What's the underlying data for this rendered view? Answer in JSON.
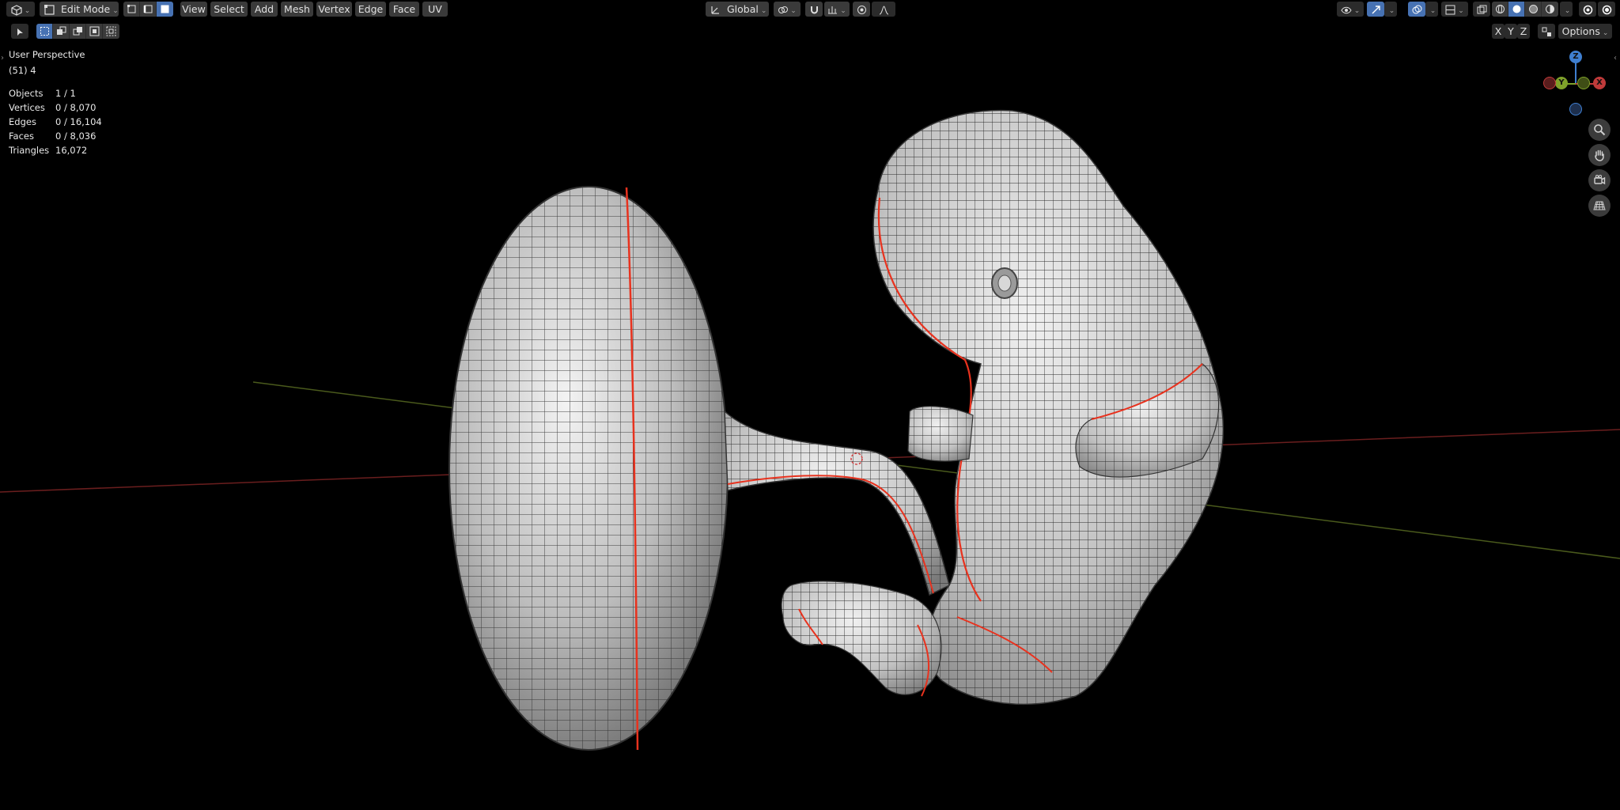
{
  "header": {
    "mode_label": "Edit Mode",
    "menus": [
      "View",
      "Select",
      "Add",
      "Mesh",
      "Vertex",
      "Edge",
      "Face",
      "UV"
    ],
    "transform_orientation": "Global",
    "axis_buttons": [
      "X",
      "Y",
      "Z"
    ],
    "options_label": "Options"
  },
  "overlay": {
    "view_name": "User Perspective",
    "object_info": "(51) 4",
    "stats": [
      {
        "label": "Objects",
        "value": "1 / 1"
      },
      {
        "label": "Vertices",
        "value": "0 / 8,070"
      },
      {
        "label": "Edges",
        "value": "0 / 16,104"
      },
      {
        "label": "Faces",
        "value": "0 / 8,036"
      },
      {
        "label": "Triangles",
        "value": "16,072"
      }
    ]
  },
  "gizmo": {
    "z_label": "Z",
    "y_label": "Y",
    "x_label": "X"
  },
  "colors": {
    "accent": "#4772b3",
    "seam": "#e8321e",
    "axis_x": "#c03a3a",
    "axis_y": "#7fa12a",
    "axis_z": "#3f7fd0"
  },
  "icons": {
    "editor_type": "cube-icon",
    "zoom": "magnifier-icon",
    "pan": "hand-icon",
    "camera": "camera-icon",
    "ortho": "grid-icon"
  }
}
